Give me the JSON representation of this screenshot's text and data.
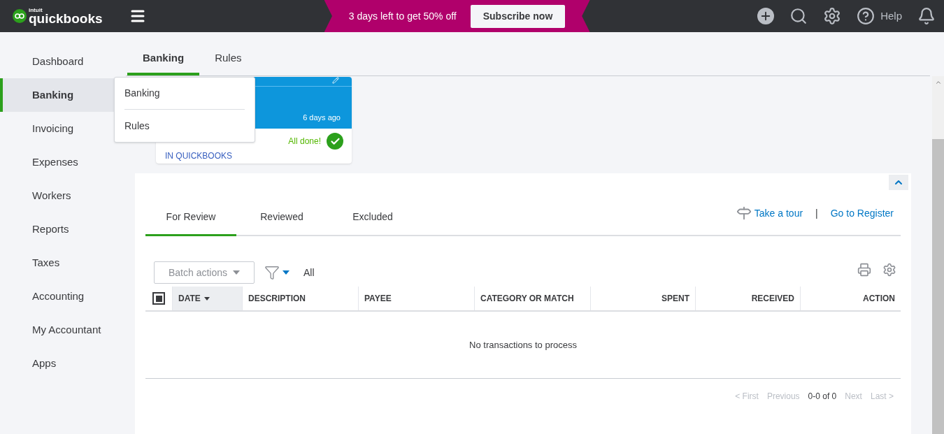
{
  "topbar": {
    "logo_small": "intuit",
    "logo": "quickbooks",
    "promo": "3 days left to get 50% off",
    "subscribe": "Subscribe now",
    "help": "Help"
  },
  "sidebar": {
    "items": [
      {
        "label": "Dashboard",
        "selected": false
      },
      {
        "label": "Banking",
        "selected": true
      },
      {
        "label": "Invoicing",
        "selected": false
      },
      {
        "label": "Expenses",
        "selected": false
      },
      {
        "label": "Workers",
        "selected": false
      },
      {
        "label": "Reports",
        "selected": false
      },
      {
        "label": "Taxes",
        "selected": false
      },
      {
        "label": "Accounting",
        "selected": false
      },
      {
        "label": "My Accountant",
        "selected": false
      },
      {
        "label": "Apps",
        "selected": false
      }
    ]
  },
  "tabs": [
    {
      "label": "Banking",
      "selected": true
    },
    {
      "label": "Rules",
      "selected": false
    }
  ],
  "flyout": [
    "Banking",
    "Rules"
  ],
  "account_card": {
    "updated": "6 days ago",
    "status": "All done!",
    "caption": "IN QUICKBOOKS"
  },
  "review_tabs": [
    {
      "label": "For Review",
      "selected": true
    },
    {
      "label": "Reviewed",
      "selected": false
    },
    {
      "label": "Excluded",
      "selected": false
    }
  ],
  "links": {
    "tour": "Take a tour",
    "separator": "|",
    "register": "Go to Register"
  },
  "toolbar": {
    "batch": "Batch actions",
    "filter": "All"
  },
  "table": {
    "select_all": {
      "checked": true
    },
    "columns": [
      {
        "label": "DATE",
        "sorted": true
      },
      {
        "label": "DESCRIPTION",
        "sorted": false
      },
      {
        "label": "PAYEE",
        "sorted": false
      },
      {
        "label": "CATEGORY OR MATCH",
        "sorted": false
      },
      {
        "label": "SPENT",
        "sorted": false
      },
      {
        "label": "RECEIVED",
        "sorted": false
      },
      {
        "label": "ACTION",
        "sorted": false
      }
    ],
    "empty": "No transactions to process"
  },
  "pagination": {
    "items": [
      {
        "label": "< First",
        "disabled": true
      },
      {
        "label": "Previous",
        "disabled": true
      },
      {
        "label": "0-0 of 0",
        "disabled": false
      },
      {
        "label": "Next",
        "disabled": true
      },
      {
        "label": "Last >",
        "disabled": true
      }
    ]
  }
}
